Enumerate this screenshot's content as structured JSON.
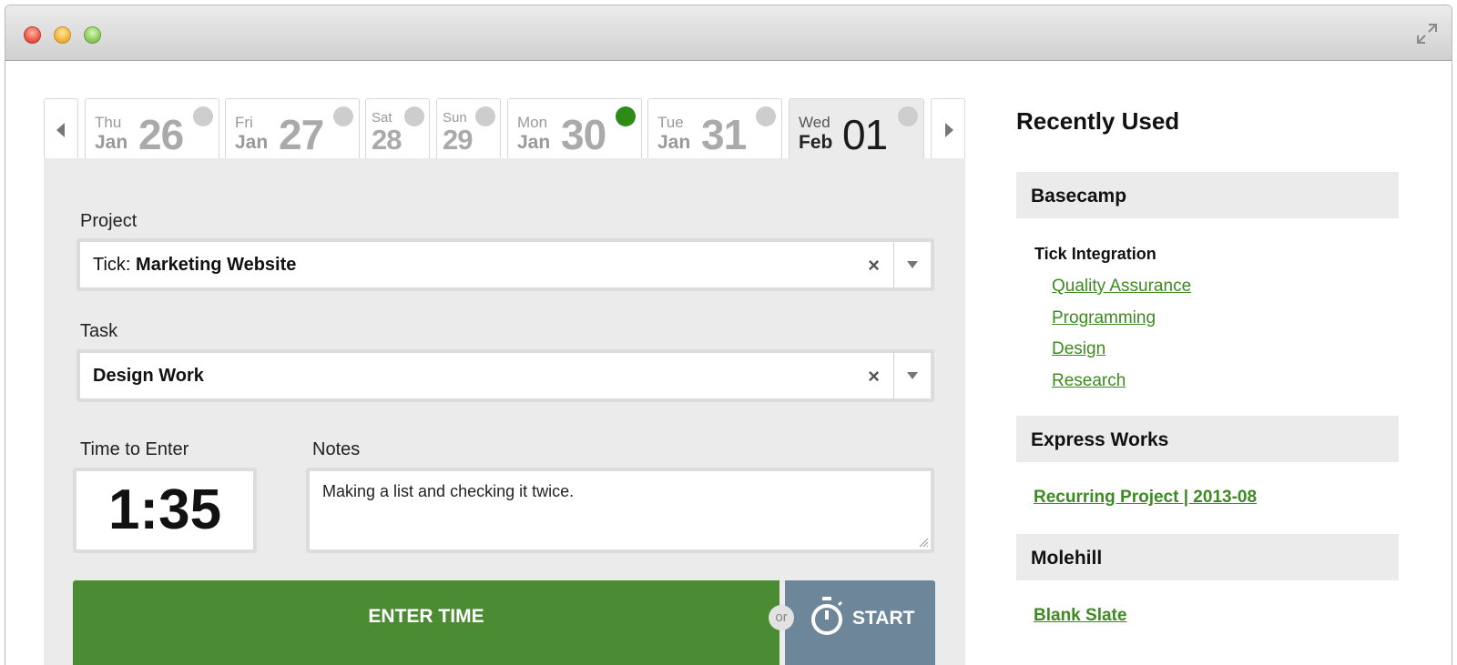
{
  "date_strip": {
    "days": [
      {
        "dow": "Thu",
        "mon": "Jan",
        "num": "26",
        "status": "grey"
      },
      {
        "dow": "Fri",
        "mon": "Jan",
        "num": "27",
        "status": "grey"
      },
      {
        "dow": "Sat",
        "mon": "",
        "num": "28",
        "status": "grey"
      },
      {
        "dow": "Sun",
        "mon": "",
        "num": "29",
        "status": "grey"
      },
      {
        "dow": "Mon",
        "mon": "Jan",
        "num": "30",
        "status": "green"
      },
      {
        "dow": "Tue",
        "mon": "Jan",
        "num": "31",
        "status": "grey"
      },
      {
        "dow": "Wed",
        "mon": "Feb",
        "num": "01",
        "status": "grey",
        "active": true
      }
    ]
  },
  "form": {
    "project_label": "Project",
    "project_prefix": "Tick:",
    "project_value": "Marketing Website",
    "task_label": "Task",
    "task_value": "Design Work",
    "clear_symbol": "×",
    "time_label": "Time to Enter",
    "time_value": "1:35",
    "notes_label": "Notes",
    "notes_value": "Making a list and checking it twice.",
    "enter_button": "ENTER TIME",
    "or_label": "or",
    "start_button": "START"
  },
  "recent": {
    "title": "Recently Used",
    "groups": [
      {
        "name": "Basecamp",
        "subproject": "Tick Integration",
        "tasks": [
          "Quality Assurance",
          "Programming",
          "Design",
          "Research"
        ]
      },
      {
        "name": "Express Works",
        "project_link": "Recurring Project | 2013-08"
      },
      {
        "name": "Molehill",
        "project_link": "Blank Slate"
      }
    ]
  },
  "colors": {
    "accent_green": "#4a8b33",
    "link_green": "#3d8a22",
    "start_slate": "#6e8699",
    "status_green": "#2e8b17",
    "status_grey": "#cdcdcd"
  }
}
